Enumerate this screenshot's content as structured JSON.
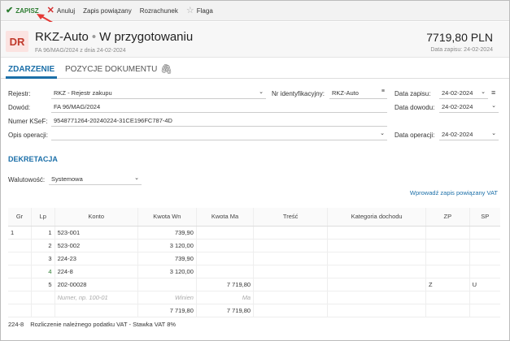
{
  "toolbar": {
    "save": "ZAPISZ",
    "cancel": "Anuluj",
    "linked": "Zapis powiązany",
    "settlement": "Rozrachunek",
    "flag": "Flaga"
  },
  "header": {
    "badge": "DR",
    "title": "RKZ-Auto",
    "status": "W przygotowaniu",
    "subtitle": "FA 96/MAG/2024 z dnia 24-02-2024",
    "amount": "7719,80 PLN",
    "save_date": "Data zapisu: 24-02-2024"
  },
  "tabs": {
    "event": "ZDARZENIE",
    "positions": "POZYCJE DOKUMENTU"
  },
  "form": {
    "register_label": "Rejestr:",
    "register_value": "RKZ - Rejestr zakupu",
    "id_label": "Nr identyfikacyjny:",
    "id_value": "RKZ-Auto",
    "save_date_label": "Data zapisu:",
    "save_date_value": "24-02-2024",
    "proof_label": "Dowód:",
    "proof_value": "FA 96/MAG/2024",
    "proof_date_label": "Data dowodu:",
    "proof_date_value": "24-02-2024",
    "ksef_label": "Numer KSeF:",
    "ksef_value": "9548771264-20240224-31CE196FC787-4D",
    "op_desc_label": "Opis operacji:",
    "op_desc_value": "",
    "op_date_label": "Data operacji:",
    "op_date_value": "24-02-2024"
  },
  "decree": {
    "title": "DEKRETACJA",
    "currency_label": "Walutowość:",
    "currency_value": "Systemowa",
    "link": "Wprowadź zapis powiązany VAT"
  },
  "table": {
    "headers": [
      "Gr",
      "Lp",
      "Konto",
      "Kwota Wn",
      "Kwota Ma",
      "Treść",
      "Kategoria dochodu",
      "ZP",
      "SP"
    ],
    "rows": [
      [
        "1",
        "1",
        "523-001",
        "739,90",
        "",
        "",
        "",
        "",
        ""
      ],
      [
        "",
        "2",
        "523-002",
        "3 120,00",
        "",
        "",
        "",
        "",
        ""
      ],
      [
        "",
        "3",
        "224-23",
        "739,90",
        "",
        "",
        "",
        "",
        ""
      ],
      [
        "",
        "4",
        "224-8",
        "3 120,00",
        "",
        "",
        "",
        "",
        ""
      ],
      [
        "",
        "5",
        "202-00028",
        "",
        "7 719,80",
        "",
        "",
        "Z",
        "U"
      ]
    ],
    "placeholder": {
      "konto": "Numer, np. 100-01",
      "wn": "Winien",
      "ma": "Ma"
    },
    "totals": {
      "wn": "7 719,80",
      "ma": "7 719,80"
    }
  },
  "footer": {
    "code": "224-8",
    "text": "Rozliczenie należnego podatku VAT - Stawka VAT 8%"
  }
}
